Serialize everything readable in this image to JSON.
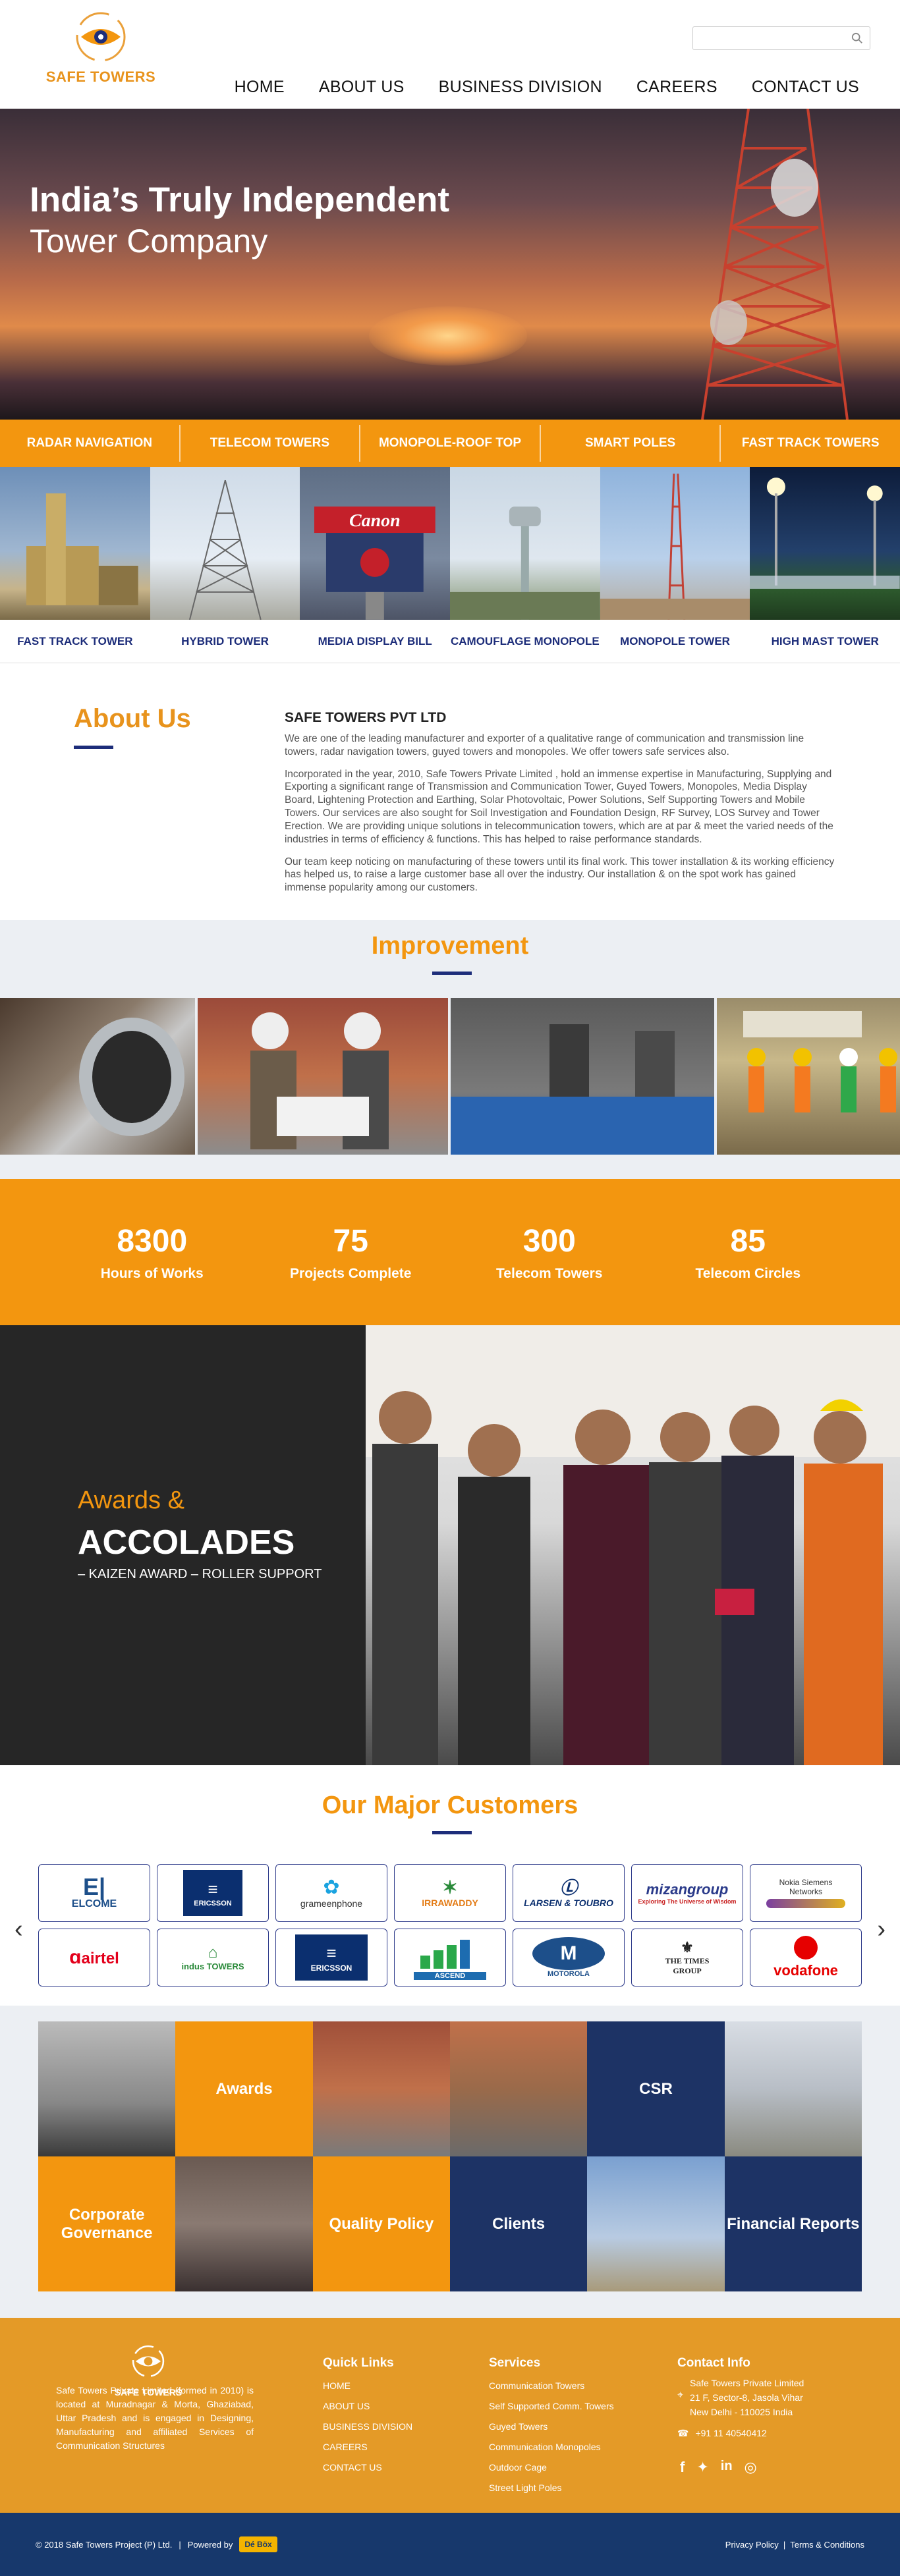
{
  "brand": {
    "name": "SAFE TOWERS",
    "color": "#e8931c",
    "navy": "#1d2d7a"
  },
  "search": {
    "placeholder": ""
  },
  "nav": [
    "HOME",
    "ABOUT US",
    "BUSINESS DIVISION",
    "CAREERS",
    "CONTACT US"
  ],
  "hero": {
    "line1": "India’s Truly Independent",
    "line2": "Tower Company"
  },
  "categories": [
    "RADAR NAVIGATION",
    "TELECOM TOWERS",
    "MONOPOLE-ROOF TOP",
    "SMART POLES",
    "FAST TRACK TOWERS"
  ],
  "products": [
    "FAST TRACK TOWER",
    "HYBRID TOWER",
    "MEDIA DISPLAY BILL",
    "CAMOUFLAGE MONOPOLE",
    "MONOPOLE TOWER",
    "HIGH MAST TOWER"
  ],
  "canon_sign": "Canon",
  "about": {
    "heading": "About Us",
    "company": "SAFE TOWERS PVT LTD",
    "p1": "We are one of the leading manufacturer and exporter of a qualitative range of communication and transmission line towers, radar navigation towers, guyed towers and monopoles. We offer towers safe services also.",
    "p2": "Incorporated in the year, 2010, Safe Towers Private Limited , hold an immense expertise in Manufacturing, Supplying and Exporting a significant range of Transmission and Communication Tower, Guyed Towers, Monopoles, Media Display Board, Lightening Protection and Earthing, Solar Photovoltaic, Power Solutions, Self Supporting Towers and Mobile Towers. Our services are also sought for Soil Investigation and Foundation Design, RF Survey, LOS Survey and Tower Erection. We are providing unique solutions in telecommunication towers, which are at par & meet the varied needs of the industries in terms of efficiency & functions. This has helped to raise performance standards.",
    "p3": "Our team keep noticing on manufacturing of these towers until its final work. This tower installation & its working efficiency has helped us, to raise a large customer base all over the industry. Our installation & on the spot work has gained immense popularity among our customers."
  },
  "improvement": {
    "heading": "Improvement"
  },
  "stats": [
    {
      "num": "8300",
      "label": "Hours of Works"
    },
    {
      "num": "75",
      "label": "Projects Complete"
    },
    {
      "num": "300",
      "label": "Telecom Towers"
    },
    {
      "num": "85",
      "label": "Telecom Circles"
    }
  ],
  "awards": {
    "line1": "Awards &",
    "line2": "ACCOLADES",
    "line3": "– KAIZEN AWARD – ROLLER SUPPORT"
  },
  "customers": {
    "heading": "Our Major Customers",
    "logos": [
      "ELCOME",
      "ERICSSON",
      "grameenphone",
      "IRRAWADDY",
      "LARSEN & TOUBRO",
      "mizangroup",
      "Nokia Siemens Networks",
      "airtel",
      "indus TOWERS",
      "ERICSSON",
      "ASCEND",
      "MOTOROLA",
      "THE TIMES GROUP",
      "vodafone"
    ],
    "mizan_tag": "Exploring The Universe of Wisdom",
    "prev": "‹",
    "next": "›"
  },
  "tiles": {
    "awards": "Awards",
    "csr": "CSR",
    "governance": "Corporate Governance",
    "quality": "Quality Policy",
    "clients": "Clients",
    "financial": "Financial Reports"
  },
  "footer": {
    "logo": "SAFE TOWERS",
    "about": "Safe Towers Private Limited (formed in 2010) is located at Muradnagar & Morta, Ghaziabad, Uttar Pradesh and is engaged in Designing, Manufacturing and affiliated Services of Communication Structures",
    "quick_links": {
      "title": "Quick Links",
      "items": [
        "HOME",
        "ABOUT US",
        "BUSINESS DIVISION",
        "CAREERS",
        "CONTACT US"
      ]
    },
    "services": {
      "title": "Services",
      "items": [
        "Communication Towers",
        "Self Supported Comm. Towers",
        "Guyed Towers",
        "Communication Monopoles",
        "Outdoor Cage",
        "Street Light Poles"
      ]
    },
    "contact": {
      "title": "Contact Info",
      "address1": "Safe Towers Private Limited",
      "address2": "21 F, Sector-8, Jasola Vihar",
      "address3": "New Delhi - 110025 India",
      "phone": "+91 11 40540412"
    }
  },
  "bottom": {
    "copy": "© 2018 Safe Towers Project (P) Ltd.",
    "powered": "Powered by",
    "box": "Dé Böx",
    "links": "Privacy Policy  |  Terms & Conditions"
  }
}
